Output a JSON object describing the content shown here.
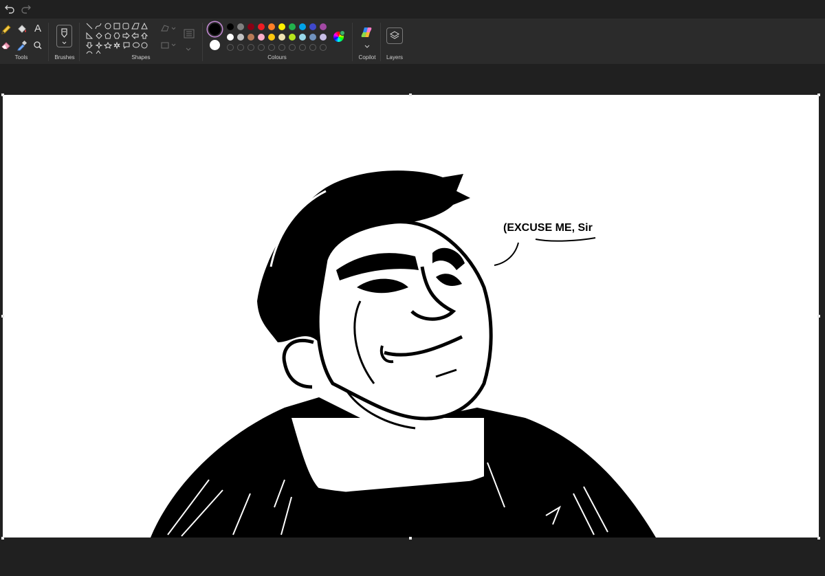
{
  "toolbar": {
    "undo_icon": "undo-icon",
    "redo_icon": "redo-icon"
  },
  "ribbon": {
    "groups": {
      "tools": "Tools",
      "brushes": "Brushes",
      "shapes": "Shapes",
      "colours": "Colours",
      "copilot": "Copilot",
      "layers": "Layers"
    },
    "tools_text_glyph": "A",
    "current_color": "#000000",
    "secondary_color": "#ffffff",
    "palette_row1": [
      "#000000",
      "#7f7f7f",
      "#880015",
      "#ed1c24",
      "#ff7f27",
      "#fff200",
      "#22b14c",
      "#00a2e8",
      "#3f48cc",
      "#a349a4"
    ],
    "palette_row2": [
      "#ffffff",
      "#c3c3c3",
      "#b97a57",
      "#ffaec9",
      "#ffc90e",
      "#efe4b0",
      "#b5e61d",
      "#99d9ea",
      "#7092be",
      "#c8bfe7"
    ]
  },
  "canvas": {
    "speech_text": "(EXCUSE ME, Sir"
  }
}
